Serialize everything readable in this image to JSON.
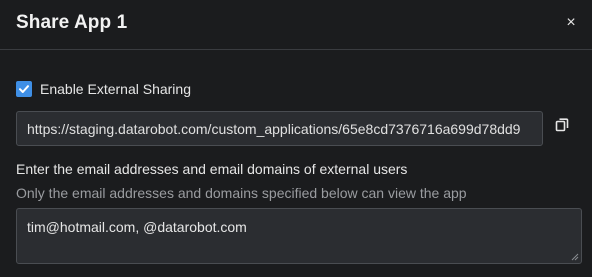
{
  "dialog": {
    "title": "Share App 1",
    "close_label": "×"
  },
  "external_sharing": {
    "checkbox_label": "Enable External Sharing",
    "checked": true,
    "url_value": "https://staging.datarobot.com/custom_applications/65e8cd7376716a699d78dd9",
    "copy_icon": "copy-icon"
  },
  "emails": {
    "instruction": "Enter the email addresses and email domains of external users",
    "sub_instruction": "Only the email addresses and domains specified below can view the app",
    "value": "tim@hotmail.com, @datarobot.com"
  },
  "colors": {
    "background": "#1b1c1e",
    "accent": "#3f8fe6",
    "field_background": "#2b2d31"
  }
}
